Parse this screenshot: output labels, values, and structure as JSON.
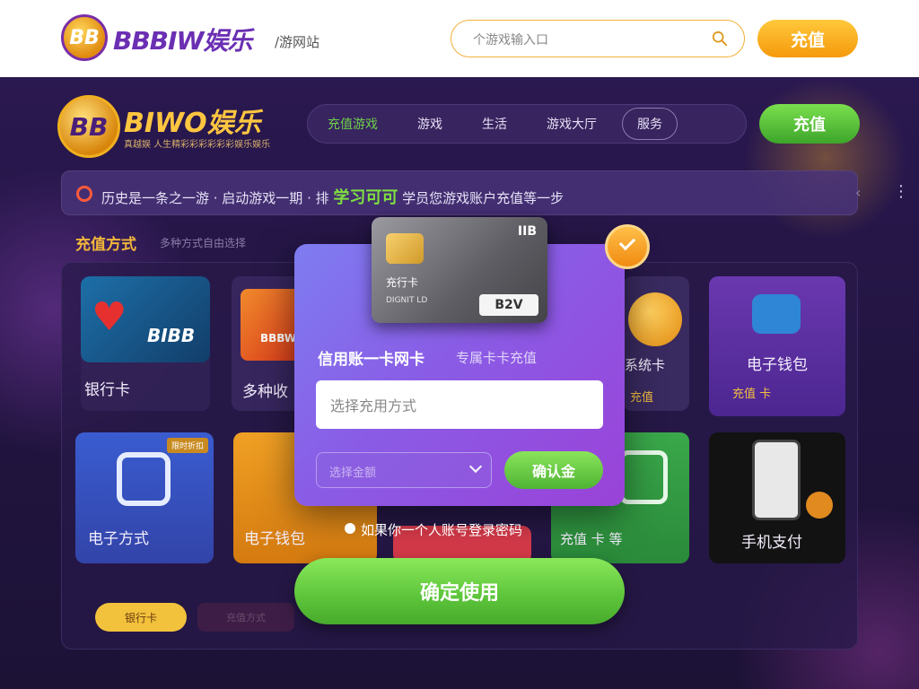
{
  "header": {
    "logo_text": "BB",
    "brand": "BBBIW娱乐",
    "subtitle": "/游网站",
    "search_placeholder": "个游戏输入口",
    "recharge_label": "充值"
  },
  "app_header": {
    "logo_text": "BB",
    "brand": "BIWO娱乐",
    "tagline": "真越娱 人生精彩彩彩彩彩彩娱乐娱乐",
    "nav": [
      {
        "label": "充值游戏",
        "active": true
      },
      {
        "label": "游戏",
        "active": false
      },
      {
        "label": "生活",
        "active": false
      },
      {
        "label": "游戏大厅",
        "active": false
      },
      {
        "label": "服务",
        "active": false
      }
    ],
    "recharge_label": "充值"
  },
  "notice": {
    "prefix": "历史是一条之一游 · 启动游戏一期 · 排 ",
    "highlight": "学习可可",
    "suffix": " 学员您游戏账户充值等一步",
    "prev_symbol": "‹",
    "more_symbol": "⋮"
  },
  "section": {
    "title": "充值方式",
    "subtitle": "多种方式自由选择"
  },
  "tiles": {
    "bank": {
      "brand": "BIBB",
      "label": "银行卡"
    },
    "multi": {
      "brand": "BBBW",
      "label": "多种收"
    },
    "partial": {
      "label": "系统卡",
      "small": "充值"
    },
    "wallet_top": {
      "label": "电子钱包",
      "row": "充值 卡"
    },
    "e_pay": {
      "badge": "限时折扣",
      "label": "电子方式"
    },
    "wallet": {
      "label": "电子钱包"
    },
    "green": {
      "label": "充值 卡 等"
    },
    "mobile": {
      "label": "手机支付"
    }
  },
  "bottom_pills": {
    "first": "银行卡",
    "second": "充值方式"
  },
  "modal": {
    "card": {
      "brand": "IIB",
      "name": "充行卡",
      "number": "DIGNIT LD",
      "tag": "B2V"
    },
    "title": "信用账一卡网卡",
    "hint": "专属卡卡充值",
    "input_placeholder": "选择充用方式",
    "select_value": "选择金额",
    "confirm_label": "确认金"
  },
  "login_hint": "如果你一个人账号登录密码",
  "primary_action": "确定使用",
  "colors": {
    "brand_purple": "#6b2fb3",
    "accent_orange": "#f5a623",
    "accent_green": "#5cc43a",
    "modal_purple": "#8a5ce6"
  }
}
